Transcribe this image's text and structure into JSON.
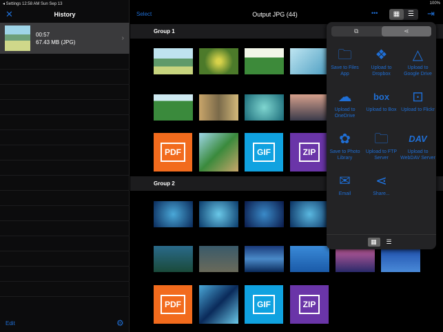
{
  "status": {
    "left": "◂ Settings  12:58 AM  Sun Sep 13",
    "right": "100%"
  },
  "sidebar": {
    "title": "History",
    "item": {
      "duration": "00:57",
      "size": "67.43 MB (JPG)"
    },
    "edit": "Edit"
  },
  "main": {
    "select": "Select",
    "title": "Output JPG (44)",
    "groups": [
      "Group 1",
      "Group 2"
    ]
  },
  "files": {
    "pdf": "PDF",
    "gif": "GIF",
    "zip": "ZIP"
  },
  "colors": {
    "accent": "#1f6fd6",
    "pdf": "#f26b1d",
    "gif": "#10a2e0",
    "zip": "#6a35a8"
  },
  "popover": {
    "items": [
      {
        "icon": "folder-icon",
        "label": "Save to Files App"
      },
      {
        "icon": "dropbox-icon",
        "label": "Upload to Dropbox"
      },
      {
        "icon": "google-drive-icon",
        "label": "Upload to Google Drive"
      },
      {
        "icon": "onedrive-icon",
        "label": "Upload to OneDrive"
      },
      {
        "icon": "box-icon",
        "label": "Upload to Box"
      },
      {
        "icon": "flickr-icon",
        "label": "Upload to Flickr"
      },
      {
        "icon": "photos-icon",
        "label": "Save to Photo Library"
      },
      {
        "icon": "ftp-icon",
        "label": "Upload to FTP Server"
      },
      {
        "icon": "webdav-icon",
        "label": "Upload to WebDAV Server"
      },
      {
        "icon": "email-icon",
        "label": "Email"
      },
      {
        "icon": "share-icon",
        "label": "Share..."
      }
    ]
  }
}
